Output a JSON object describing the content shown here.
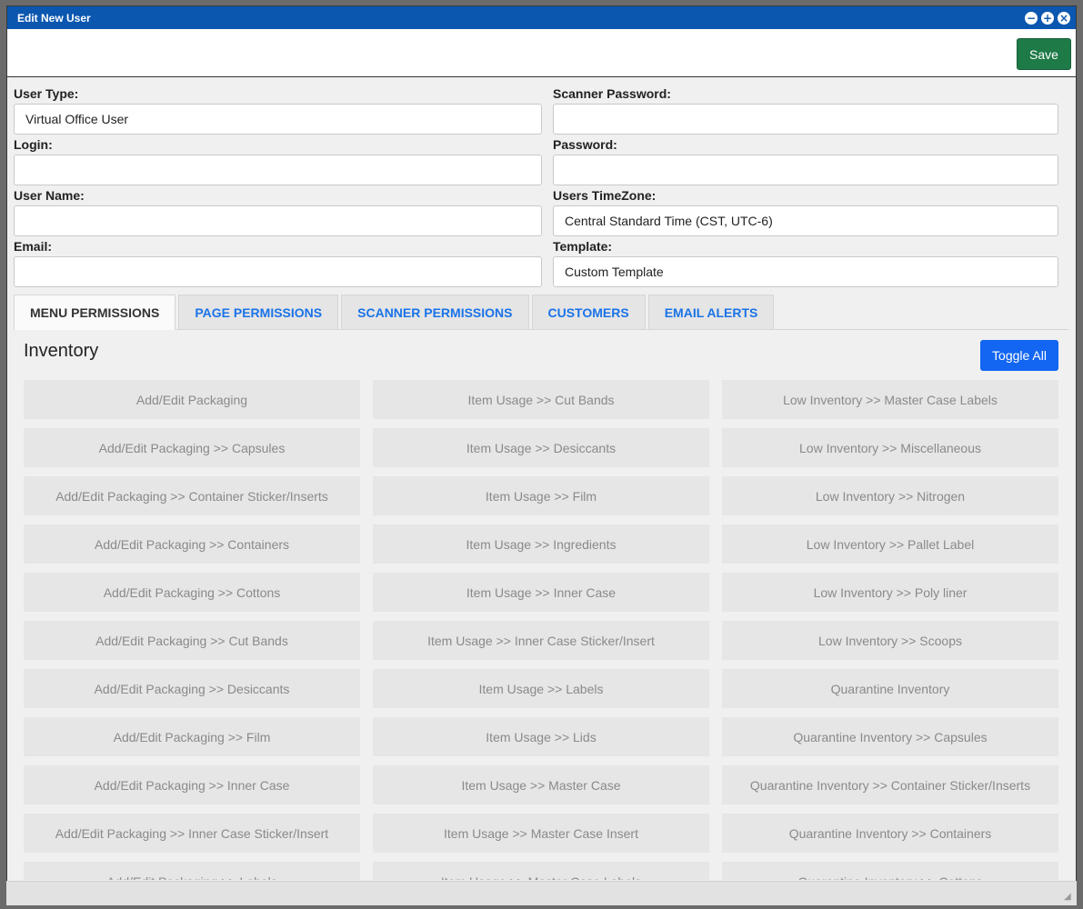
{
  "window": {
    "title": "Edit New User",
    "controls": {
      "minimize": "−",
      "maximize": "+",
      "close": "×"
    }
  },
  "toolbar": {
    "save_label": "Save"
  },
  "form": {
    "left": [
      {
        "label": "User Type:",
        "value": "Virtual Office User"
      },
      {
        "label": "Login:",
        "value": ""
      },
      {
        "label": "User Name:",
        "value": ""
      },
      {
        "label": "Email:",
        "value": ""
      }
    ],
    "right": [
      {
        "label": "Scanner Password:",
        "value": ""
      },
      {
        "label": "Password:",
        "value": ""
      },
      {
        "label": "Users TimeZone:",
        "value": "Central Standard Time (CST, UTC-6)"
      },
      {
        "label": "Template:",
        "value": "Custom Template"
      }
    ]
  },
  "tabs": [
    {
      "label": "MENU PERMISSIONS",
      "active": true
    },
    {
      "label": "PAGE PERMISSIONS",
      "active": false
    },
    {
      "label": "SCANNER PERMISSIONS",
      "active": false
    },
    {
      "label": "CUSTOMERS",
      "active": false
    },
    {
      "label": "EMAIL ALERTS",
      "active": false
    }
  ],
  "panel": {
    "section_title": "Inventory",
    "toggle_all_label": "Toggle All",
    "permissions": [
      "Add/Edit Packaging",
      "Item Usage >> Cut Bands",
      "Low Inventory >> Master Case Labels",
      "Add/Edit Packaging >> Capsules",
      "Item Usage >> Desiccants",
      "Low Inventory >> Miscellaneous",
      "Add/Edit Packaging >> Container Sticker/Inserts",
      "Item Usage >> Film",
      "Low Inventory >> Nitrogen",
      "Add/Edit Packaging >> Containers",
      "Item Usage >> Ingredients",
      "Low Inventory >> Pallet Label",
      "Add/Edit Packaging >> Cottons",
      "Item Usage >> Inner Case",
      "Low Inventory >> Poly liner",
      "Add/Edit Packaging >> Cut Bands",
      "Item Usage >> Inner Case Sticker/Insert",
      "Low Inventory >> Scoops",
      "Add/Edit Packaging >> Desiccants",
      "Item Usage >> Labels",
      "Quarantine Inventory",
      "Add/Edit Packaging >> Film",
      "Item Usage >> Lids",
      "Quarantine Inventory >> Capsules",
      "Add/Edit Packaging >> Inner Case",
      "Item Usage >> Master Case",
      "Quarantine Inventory >> Container Sticker/Inserts",
      "Add/Edit Packaging >> Inner Case Sticker/Insert",
      "Item Usage >> Master Case Insert",
      "Quarantine Inventory >> Containers",
      "Add/Edit Packaging >> Labels",
      "Item Usage >> Master Case Labels",
      "Quarantine Inventory >> Cottons"
    ]
  },
  "colors": {
    "titlebar": "#0b57b0",
    "save_button": "#1e7a46",
    "toggle_button": "#1266f1",
    "tab_link": "#1a73e8"
  }
}
